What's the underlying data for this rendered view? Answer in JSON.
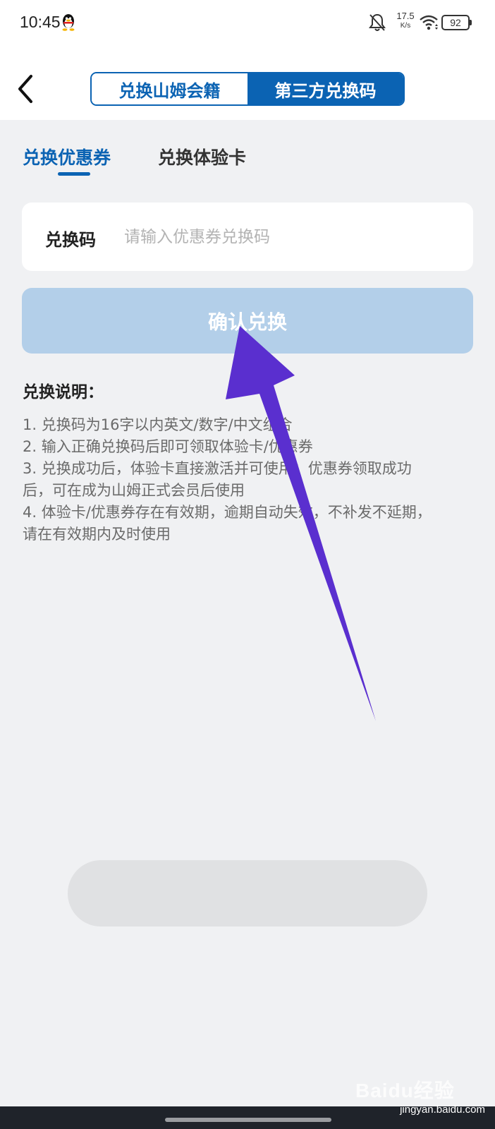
{
  "status_bar": {
    "time": "10:45",
    "net_speed_value": "17.5",
    "net_speed_unit": "K/s",
    "battery": "92"
  },
  "header": {
    "segments": [
      "兑换山姆会籍",
      "第三方兑换码"
    ],
    "active_segment": "第三方兑换码"
  },
  "sub_tabs": {
    "items": [
      "兑换优惠券",
      "兑换体验卡"
    ],
    "active": "兑换优惠券"
  },
  "redeem_form": {
    "label": "兑换码",
    "placeholder": "请输入优惠券兑换码",
    "value": "",
    "confirm_label": "确认兑换"
  },
  "instructions": {
    "title": "兑换说明：",
    "items": [
      "1. 兑换码为16字以内英文/数字/中文组合",
      "2. 输入正确兑换码后即可领取体验卡/优惠券",
      "3. 兑换成功后，体验卡直接激活并可使用；优惠券领取成功",
      "后，可在成为山姆正式会员后使用",
      "4. 体验卡/优惠券存在有效期，逾期自动失效，不补发不延期，",
      "请在有效期内及时使用"
    ]
  },
  "watermark": {
    "brand": "Baidu经验",
    "site": "jingyan.baidu.com"
  },
  "colors": {
    "brand_blue": "#0b63b3",
    "button_disabled": "#b3cfe9",
    "arrow_annotation": "#5a2fcf",
    "page_bg": "#f0f1f3"
  }
}
